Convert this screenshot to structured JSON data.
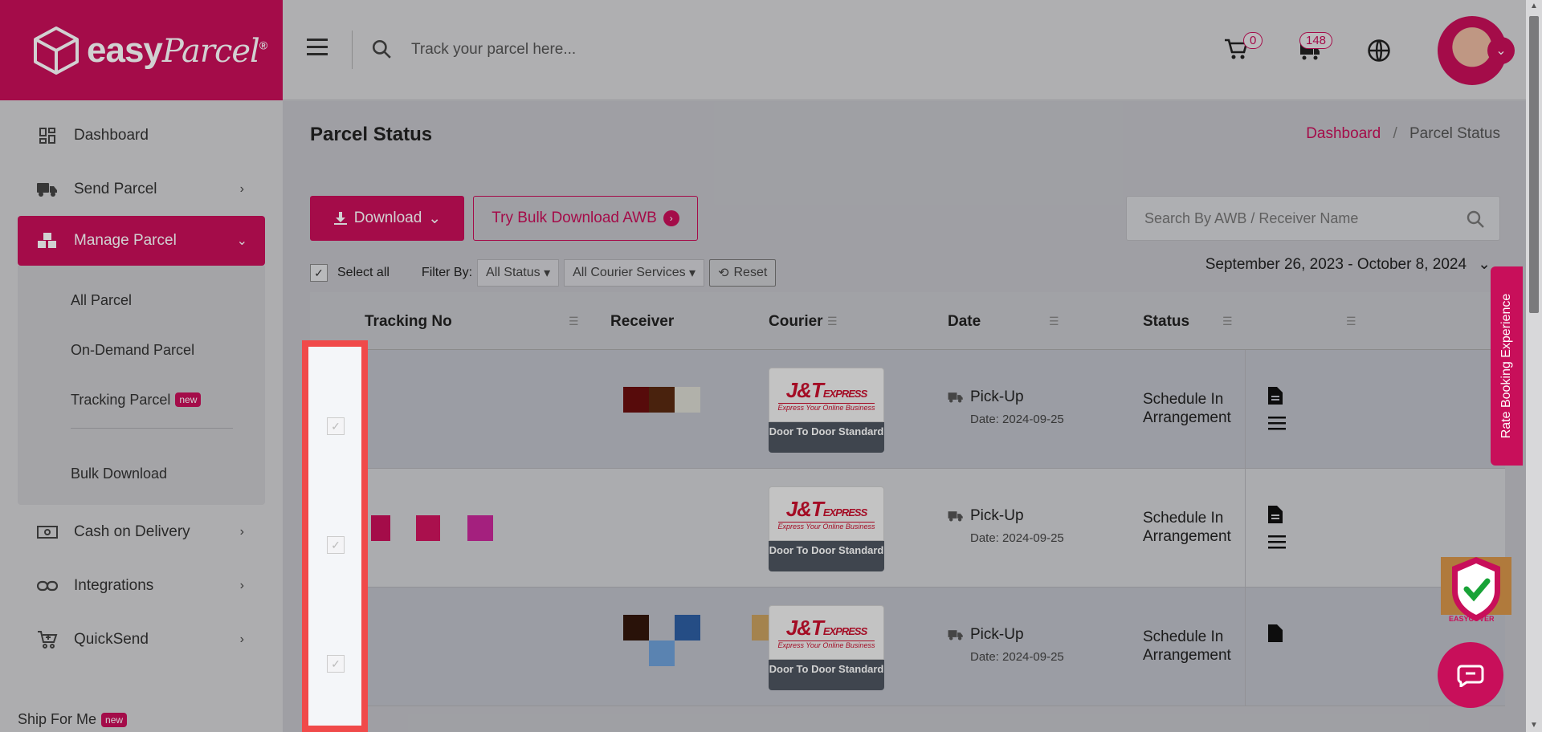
{
  "brand": {
    "name": "easy",
    "script": "Parcel",
    "reg": "®"
  },
  "sidebar": {
    "items": [
      {
        "label": "Dashboard",
        "icon": "dashboard-icon"
      },
      {
        "label": "Send Parcel",
        "icon": "truck-icon"
      },
      {
        "label": "Manage Parcel",
        "icon": "boxes-icon"
      },
      {
        "label": "Cash on Delivery",
        "icon": "cash-icon"
      },
      {
        "label": "Integrations",
        "icon": "link-icon"
      },
      {
        "label": "QuickSend",
        "icon": "cart-plus-icon"
      }
    ],
    "submenu": [
      {
        "label": "All Parcel"
      },
      {
        "label": "On-Demand Parcel"
      },
      {
        "label": "Tracking Parcel",
        "badge": "new"
      },
      {
        "label": "Bulk Download"
      }
    ],
    "ship_for_me": {
      "label": "Ship For Me",
      "badge": "new"
    }
  },
  "header": {
    "search_placeholder": "Track your parcel here...",
    "cart_count": "0",
    "notification_count": "148"
  },
  "page": {
    "title": "Parcel Status",
    "breadcrumb": {
      "home": "Dashboard",
      "current": "Parcel Status"
    },
    "download_label": "Download",
    "bulk_label": "Try Bulk Download AWB",
    "search_placeholder": "Search By AWB / Receiver Name",
    "select_all": "Select all",
    "filter_by": "Filter By:",
    "status_filter": "All Status",
    "courier_filter": "All Courier Services",
    "reset_label": "Reset",
    "date_range": "September 26, 2023 - October 8, 2024"
  },
  "table": {
    "headers": {
      "tracking": "Tracking No",
      "receiver": "Receiver",
      "courier": "Courier",
      "date": "Date",
      "status": "Status"
    },
    "rows": [
      {
        "courier_logo": "J&T",
        "courier_sub": "EXPRESS",
        "courier_tag": "Express Your Online Business",
        "service": "Door To Door Standard",
        "type": "Pick-Up",
        "date": "Date: 2024-09-25",
        "status": "Schedule In Arrangement"
      },
      {
        "courier_logo": "J&T",
        "courier_sub": "EXPRESS",
        "courier_tag": "Express Your Online Business",
        "service": "Door To Door Standard",
        "type": "Pick-Up",
        "date": "Date: 2024-09-25",
        "status": "Schedule In Arrangement"
      },
      {
        "courier_logo": "J&T",
        "courier_sub": "EXPRESS",
        "courier_tag": "Express Your Online Business",
        "service": "Door To Door Standard",
        "type": "Pick-Up",
        "date": "Date: 2024-09-25",
        "status": "Schedule In Arrangement"
      }
    ]
  },
  "widgets": {
    "rate_label": "Rate Booking Experience",
    "easycover": "EASYCOVER"
  },
  "colors": {
    "brand": "#c80f5a",
    "highlight": "#f04a4a"
  }
}
